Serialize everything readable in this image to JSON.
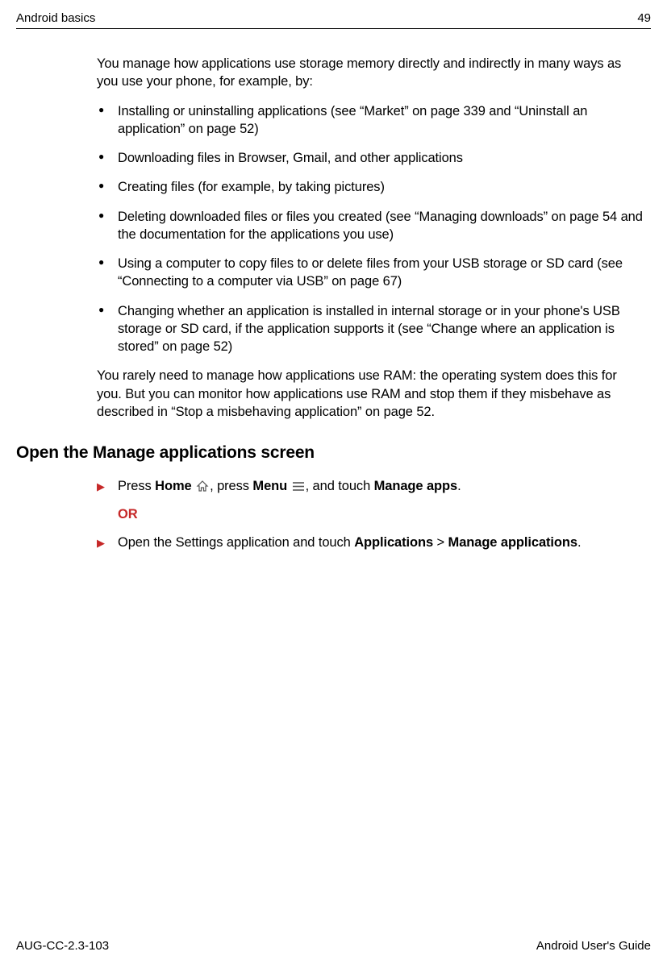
{
  "header": {
    "left": "Android basics",
    "right": "49"
  },
  "intro": "You manage how applications use storage memory directly and indirectly in many ways as you use your phone, for example, by:",
  "bullets": [
    "Installing or uninstalling applications (see “Market” on page 339 and “Uninstall an application” on page 52)",
    "Downloading files in Browser, Gmail, and other applications",
    "Creating files (for example, by taking pictures)",
    "Deleting downloaded files or files you created (see “Managing downloads” on page 54 and the documentation for the applications you use)",
    "Using a computer to copy files to or delete files from your USB storage or SD card (see “Connecting to a computer via USB” on page 67)",
    "Changing whether an application is installed in internal storage or in your phone's USB storage or SD card, if the application supports it (see “Change where an appli­cation is stored” on page 52)"
  ],
  "after_bullets": "You rarely need to manage how applications use RAM: the operating system does this for you. But you can monitor how applications use RAM and stop them if they misbehave as described in “Stop a misbehaving application” on page 52.",
  "section_heading": "Open the Manage applications screen",
  "step1": {
    "press": "Press ",
    "home_bold": "Home",
    "mid1": ", press ",
    "menu_bold": "Menu",
    "mid2": ", and touch ",
    "manage_apps_bold": "Manage apps",
    "end": ".",
    "or": "OR"
  },
  "step2": {
    "prefix": "Open the Settings application and touch ",
    "applications_bold": "Applications",
    "gt": " > ",
    "manage_bold": "Manage applications",
    "end": "."
  },
  "footer": {
    "left": "AUG-CC-2.3-103",
    "right": "Android User's Guide"
  }
}
